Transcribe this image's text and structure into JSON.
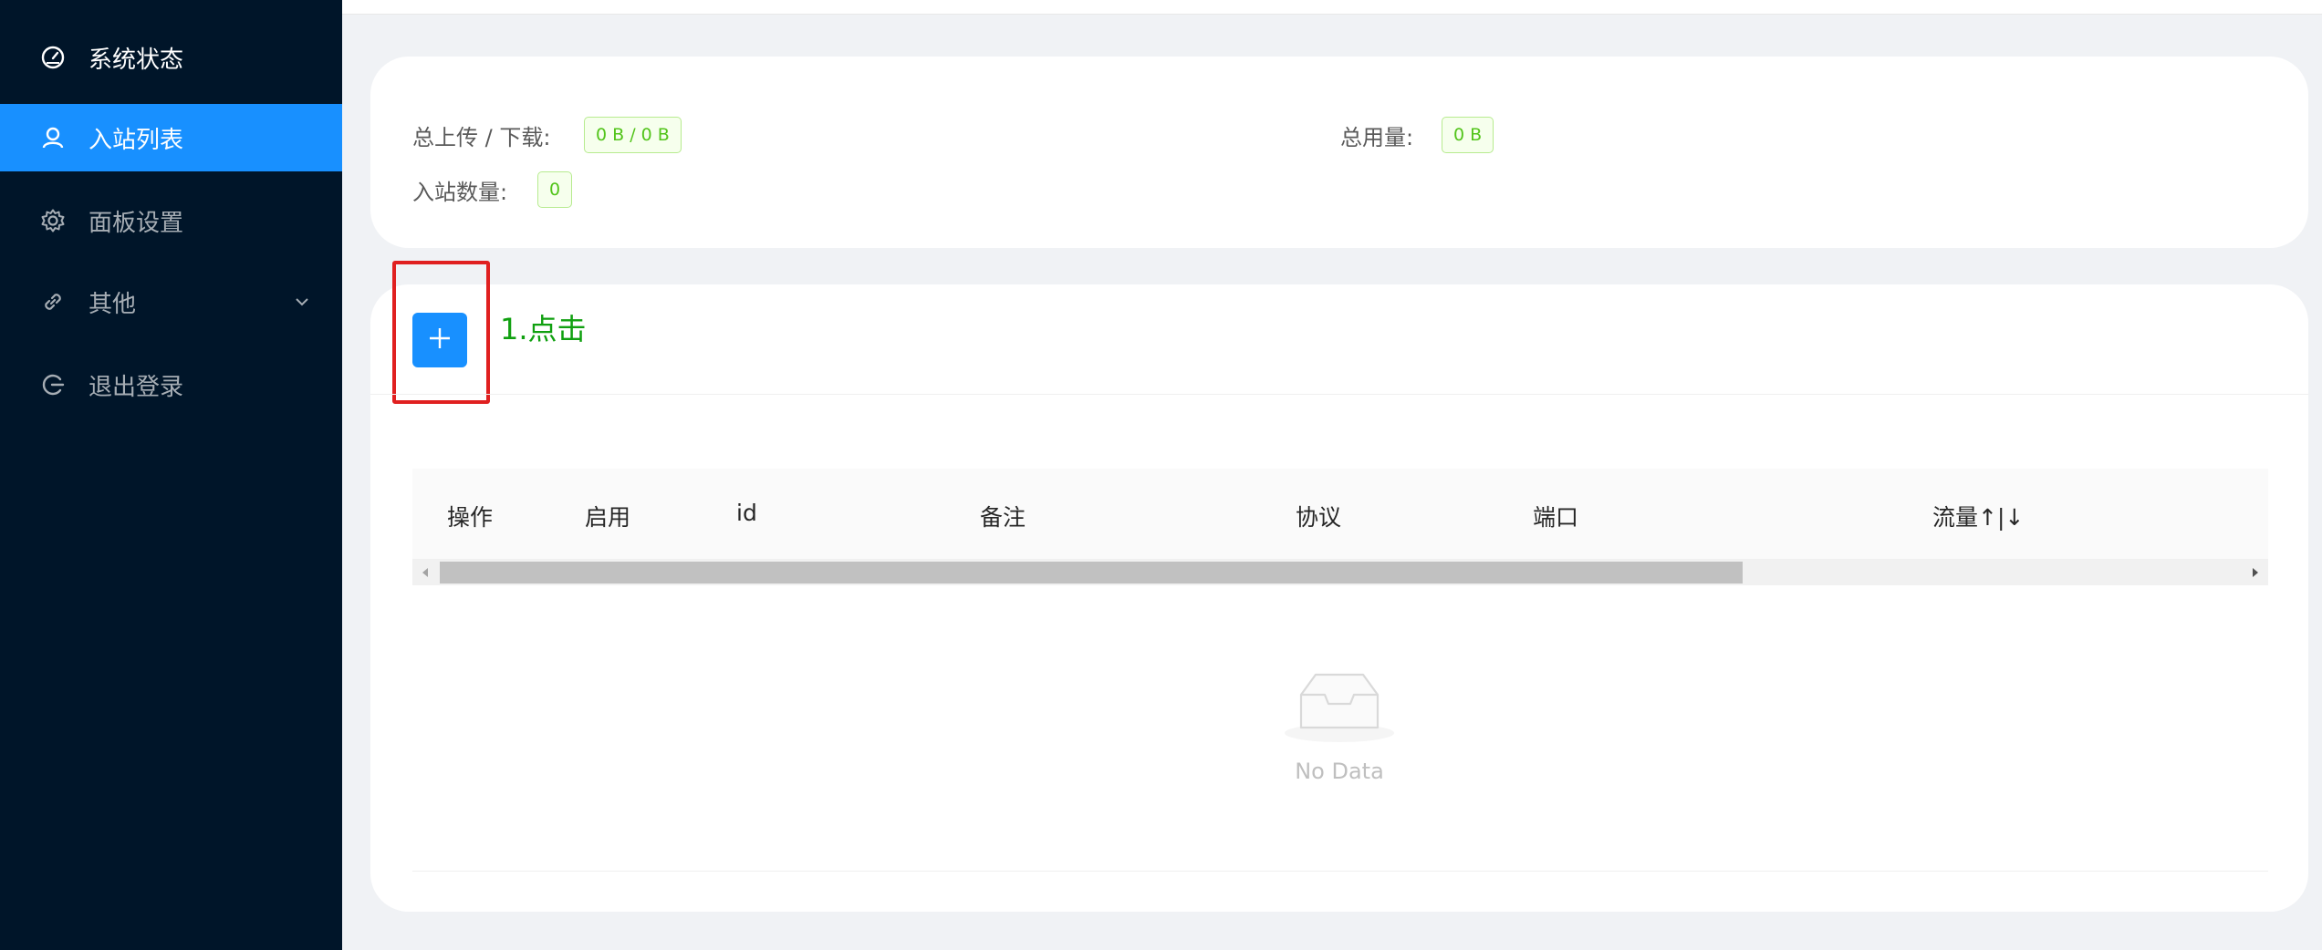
{
  "sidebar": {
    "items": [
      {
        "label": "系统状态",
        "icon": "dashboard-icon"
      },
      {
        "label": "入站列表",
        "icon": "user-icon"
      },
      {
        "label": "面板设置",
        "icon": "gear-icon"
      },
      {
        "label": "其他",
        "icon": "link-icon"
      },
      {
        "label": "退出登录",
        "icon": "logout-icon"
      }
    ]
  },
  "stats": {
    "traffic_label": "总上传 / 下载:",
    "traffic_value": "0 B / 0 B",
    "usage_label": "总用量:",
    "usage_value": "0 B",
    "inbound_count_label": "入站数量:",
    "inbound_count_value": "0"
  },
  "toolbar": {
    "add_button_icon": "plus-icon",
    "annotation": "1.点击"
  },
  "table": {
    "columns": [
      "操作",
      "启用",
      "id",
      "备注",
      "协议",
      "端口",
      "流量↑|↓"
    ],
    "rows": [],
    "empty_text": "No Data"
  },
  "colors": {
    "sidebar_bg": "#001529",
    "accent": "#1890ff",
    "tag_green": "#52c41a",
    "annotation_red": "#e02020",
    "annotation_green": "#10a010"
  }
}
